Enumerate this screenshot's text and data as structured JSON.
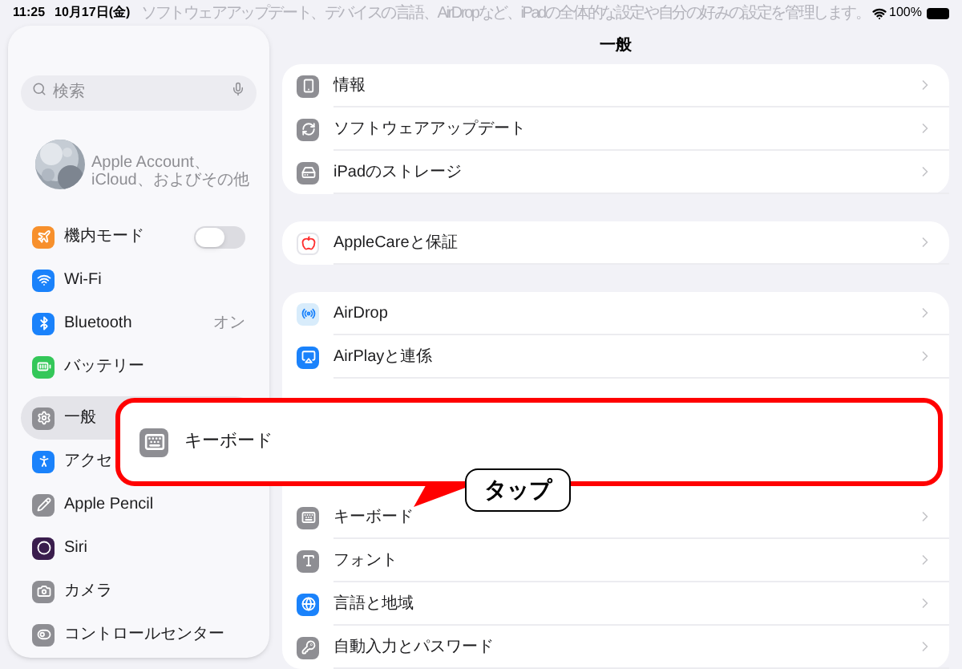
{
  "status_bar": {
    "time": "11:25",
    "date": "10月17日(金)",
    "battery": "100%"
  },
  "faded_header": "ソフトウェアアップデート、デバイスの言語、AirDropなど、iPadの全体的な設定や自分の好みの設定を管理します。",
  "sidebar": {
    "search": {
      "placeholder": "検索"
    },
    "account": {
      "subtitle": "Apple Account、iCloud、およびその他"
    },
    "groups": [
      [
        {
          "label": "機内モード",
          "kind": "toggle",
          "on": false,
          "selected": false
        },
        {
          "label": "Wi-Fi",
          "kind": "link",
          "selected": false
        },
        {
          "label": "Bluetooth",
          "kind": "value",
          "value": "オン",
          "selected": false
        },
        {
          "label": "バッテリー",
          "kind": "link",
          "selected": false
        }
      ],
      [
        {
          "label": "一般",
          "kind": "link",
          "selected": true
        },
        {
          "label": "アクセ",
          "kind": "link",
          "selected": false
        },
        {
          "label": "Apple Pencil",
          "kind": "link",
          "selected": false
        },
        {
          "label": "Siri",
          "kind": "link",
          "selected": false
        },
        {
          "label": "カメラ",
          "kind": "link",
          "selected": false
        },
        {
          "label": "コントロールセンター",
          "kind": "link",
          "selected": false
        }
      ]
    ]
  },
  "main": {
    "title": "一般",
    "groups": [
      [
        {
          "label": "情報",
          "kind": "row"
        },
        {
          "label": "ソフトウェアアップデート",
          "kind": "row"
        },
        {
          "label": "iPadのストレージ",
          "kind": "row"
        }
      ],
      [
        {
          "label": "AppleCareと保証",
          "kind": "row"
        }
      ],
      [
        {
          "label": "AirDrop",
          "kind": "row"
        },
        {
          "label": "AirPlayと連係",
          "kind": "row"
        },
        {
          "kind": "hidden"
        },
        {
          "label": "キーボード",
          "kind": "row"
        },
        {
          "label": "フォント",
          "kind": "row"
        },
        {
          "label": "言語と地域",
          "kind": "row"
        },
        {
          "label": "自動入力とパスワード",
          "kind": "row"
        }
      ]
    ]
  },
  "callout": {
    "label": "キーボード"
  },
  "annotation": {
    "label": "タップ"
  }
}
